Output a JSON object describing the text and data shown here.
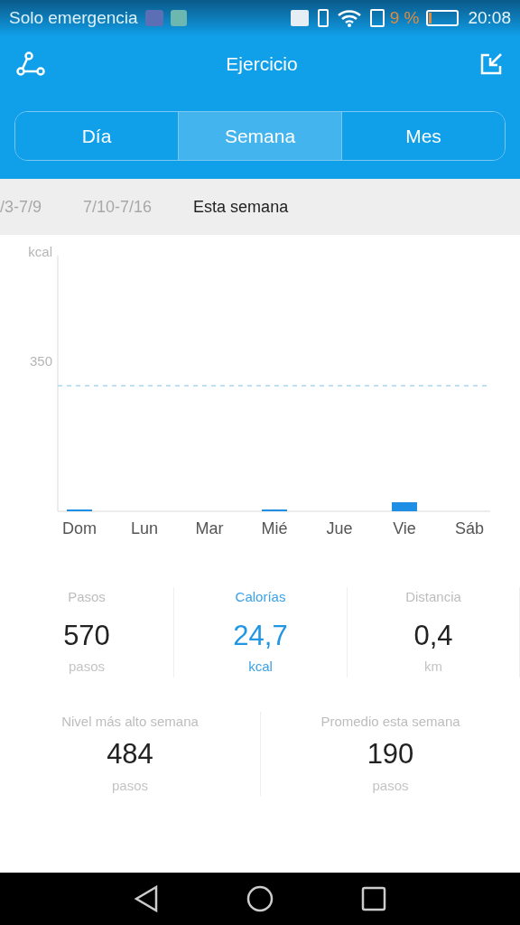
{
  "status_bar": {
    "carrier": "Solo emergencia",
    "battery_percent": "9 %",
    "time": "20:08"
  },
  "header": {
    "title": "Ejercicio"
  },
  "tabs": [
    {
      "label": "Día",
      "selected": false
    },
    {
      "label": "Semana",
      "selected": true
    },
    {
      "label": "Mes",
      "selected": false
    }
  ],
  "weeks": [
    {
      "label": "/3-7/9",
      "selected": false
    },
    {
      "label": "7/10-7/16",
      "selected": false
    },
    {
      "label": "Esta semana",
      "selected": true
    }
  ],
  "chart": {
    "unit": "kcal",
    "tick": "350",
    "days": [
      "Dom",
      "Lun",
      "Mar",
      "Mié",
      "Jue",
      "Vie",
      "Sáb"
    ]
  },
  "stats": [
    {
      "label": "Pasos",
      "value": "570",
      "unit": "pasos",
      "selected": false
    },
    {
      "label": "Calorías",
      "value": "24,7",
      "unit": "kcal",
      "selected": true
    },
    {
      "label": "Distancia",
      "value": "0,4",
      "unit": "km",
      "selected": false
    }
  ],
  "summary": [
    {
      "label": "Nivel más alto semana",
      "value": "484",
      "unit": "pasos"
    },
    {
      "label": "Promedio esta semana",
      "value": "190",
      "unit": "pasos"
    }
  ]
}
